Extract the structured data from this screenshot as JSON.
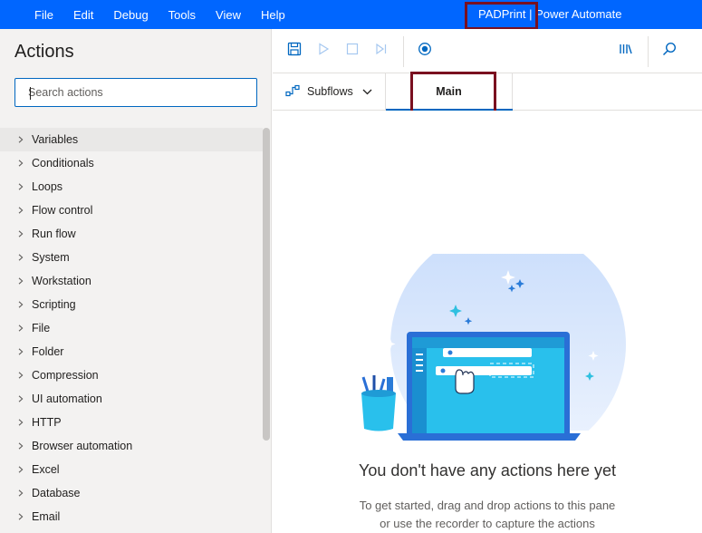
{
  "menu": [
    "File",
    "Edit",
    "Debug",
    "Tools",
    "View",
    "Help"
  ],
  "app_title": "PADPrint | Power Automate",
  "actions_panel": {
    "title": "Actions",
    "search_placeholder": "Search actions",
    "items": [
      "Variables",
      "Conditionals",
      "Loops",
      "Flow control",
      "Run flow",
      "System",
      "Workstation",
      "Scripting",
      "File",
      "Folder",
      "Compression",
      "UI automation",
      "HTTP",
      "Browser automation",
      "Excel",
      "Database",
      "Email"
    ]
  },
  "toolbar": {
    "icons": [
      "save-icon",
      "run-icon",
      "stop-icon",
      "next-step-icon",
      "recorder-icon",
      "variables-icon",
      "search-icon"
    ]
  },
  "tabs": {
    "subflows_label": "Subflows",
    "main_label": "Main"
  },
  "empty_state": {
    "title": "You don't have any actions here yet",
    "line1": "To get started, drag and drop actions to this pane",
    "line2": "or use the recorder to capture the actions"
  },
  "colors": {
    "accent": "#0066ff",
    "highlight": "#7a1020",
    "tab_underline": "#0067c0"
  }
}
